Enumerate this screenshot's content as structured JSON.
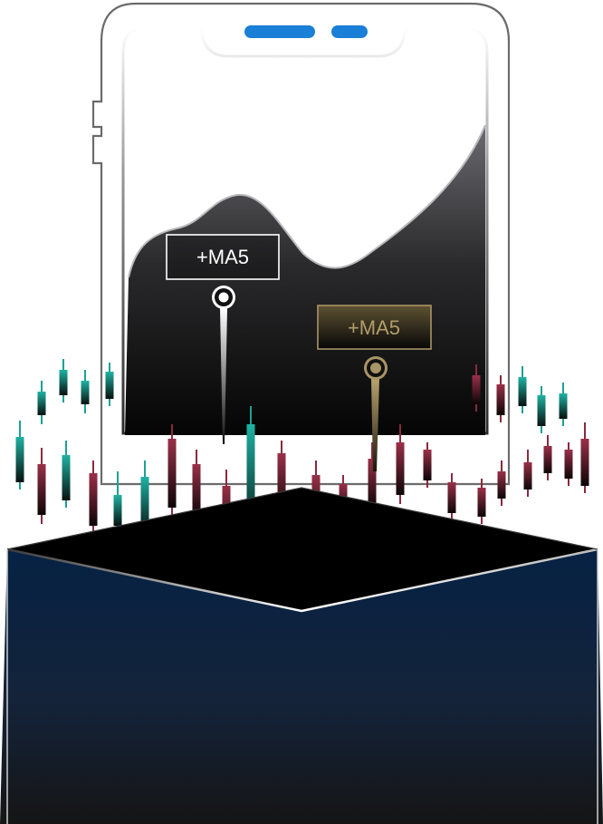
{
  "tags": [
    {
      "label": "+MA5",
      "style": "white"
    },
    {
      "label": "+MA5",
      "style": "gold"
    }
  ],
  "colors": {
    "phone_outline": "#6e6e6e",
    "notch_pill": "#1a7fd6",
    "area_top": "#5c5c62",
    "area_bottom": "#0b0b0b",
    "gold": "#a89565",
    "white_tag": "#ffffff",
    "candle_up": "#1aa195",
    "candle_down": "#8a2a3e",
    "box_top": "#000000",
    "box_front_top": "#0b2240",
    "box_front_bottom": "#121212"
  },
  "icons": [
    "white-marker-pin-icon",
    "gold-marker-pin-icon"
  ]
}
